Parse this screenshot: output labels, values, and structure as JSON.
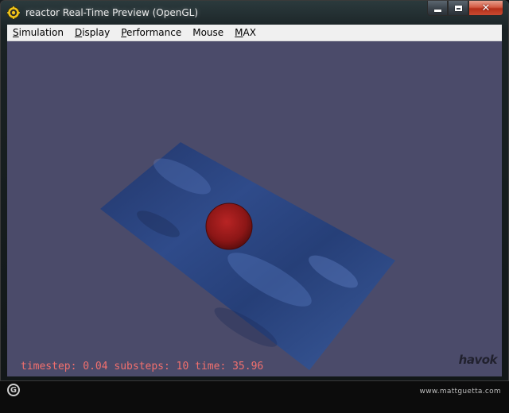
{
  "window": {
    "title": "reactor Real-Time Preview (OpenGL)",
    "close_glyph": "✕"
  },
  "menu": [
    {
      "mnemonic": "S",
      "rest": "imulation"
    },
    {
      "mnemonic": "D",
      "rest": "isplay"
    },
    {
      "mnemonic": "P",
      "rest": "erformance"
    },
    {
      "mnemonic": "",
      "rest": "Mouse"
    },
    {
      "mnemonic": "M",
      "rest": "AX"
    }
  ],
  "viewport": {
    "background": "#4b4b6a",
    "hud": "timestep: 0.04 substeps: 10 time: 35.96",
    "hud_color": "#f2706e",
    "logo": "havok",
    "plane_color": "#2e4a86",
    "ball_color": "#9a1a1a"
  },
  "footer": {
    "g_logo": "G",
    "watermark": "www.mattguetta.com"
  },
  "icons": {
    "app": "reactor-gear-icon",
    "minimize": "minimize-icon",
    "maximize": "maximize-icon",
    "close": "close-icon"
  }
}
